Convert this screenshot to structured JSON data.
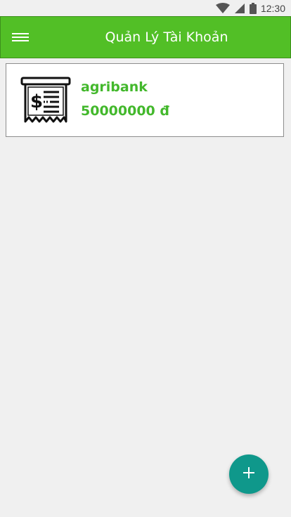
{
  "status_bar": {
    "time": "12:30",
    "icons": [
      "wifi-icon",
      "signal-icon",
      "battery-icon"
    ]
  },
  "app_bar": {
    "title": "Quản Lý Tài Khoản",
    "menu_icon": "hamburger-menu-icon",
    "color": "#52bf26"
  },
  "accounts": [
    {
      "icon": "receipt-icon",
      "name": "agribank",
      "balance": "50000000 đ"
    }
  ],
  "fab": {
    "icon": "plus-icon",
    "color": "#0f988b"
  },
  "colors": {
    "primary": "#52bf26",
    "text_accent": "#43b82c",
    "background": "#f0f0f0"
  }
}
